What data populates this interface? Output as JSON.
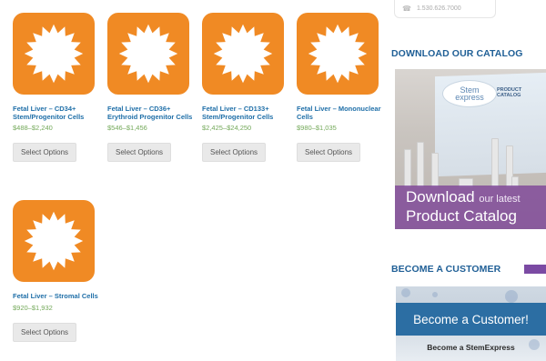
{
  "products": [
    {
      "name": "Fetal Liver – CD34+ Stem/Progenitor Cells",
      "price": "$488–$2,240",
      "button": "Select Options"
    },
    {
      "name": "Fetal Liver – CD36+ Erythroid Progenitor Cells",
      "price": "$546–$1,456",
      "button": "Select Options"
    },
    {
      "name": "Fetal Liver – CD133+ Stem/Progenitor Cells",
      "price": "$2,425–$24,250",
      "button": "Select Options"
    },
    {
      "name": "Fetal Liver – Mononuclear Cells",
      "price": "$980–$1,035",
      "button": "Select Options"
    },
    {
      "name": "Fetal Liver – Stromal Cells",
      "price": "$920–$1,932",
      "button": "Select Options"
    }
  ],
  "product_icon": "sun-icon",
  "colors": {
    "thumb": "#f08a24",
    "product_link": "#1f6fa8",
    "price": "#74a95a",
    "section_title": "#1f5f96",
    "accent_purple": "#7b4aa3"
  },
  "sidebar": {
    "phone": "1.530.626.7000",
    "catalog_title": "DOWNLOAD OUR CATALOG",
    "catalog_banner": {
      "logo_top": "Stem",
      "logo_bottom": "express",
      "logo_label": "PRODUCT CATALOG",
      "download": "Download",
      "our_latest": "our latest",
      "line2": "Product Catalog"
    },
    "customer_title": "BECOME A CUSTOMER",
    "customer_banner": {
      "headline": "Become a Customer!",
      "sub": "Become a StemExpress"
    }
  }
}
